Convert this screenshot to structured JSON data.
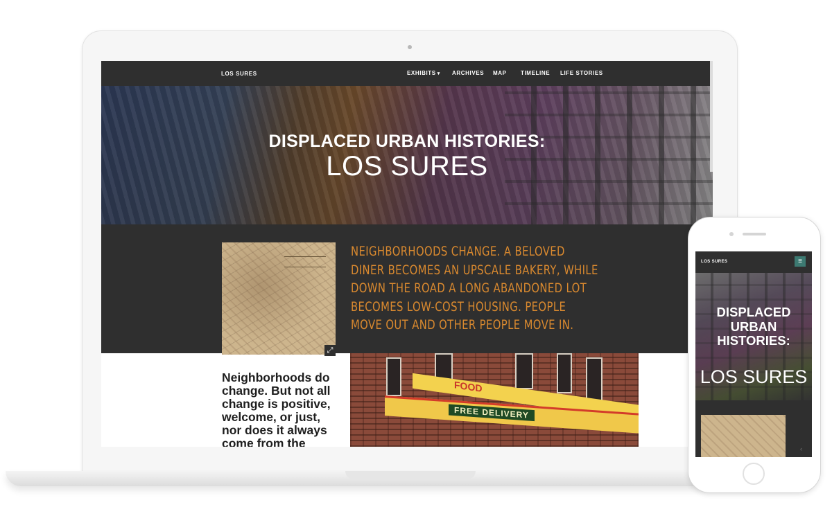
{
  "laptop": {
    "navbar": {
      "brand": "LOS SURES",
      "items": [
        {
          "label": "EXHIBITS",
          "has_dropdown": true
        },
        {
          "label": "ARCHIVES"
        },
        {
          "label": "MAP"
        },
        {
          "label": "TIMELINE"
        },
        {
          "label": "LIFE STORIES"
        }
      ],
      "caret": "▾"
    },
    "hero": {
      "title": "DISPLACED URBAN HISTORIES:",
      "subtitle": "LOS SURES"
    },
    "intro": {
      "text": "NEIGHBORHOODS CHANGE. A BELOVED DINER BECOMES AN UPSCALE BAKERY, WHILE DOWN THE ROAD A LONG ABANDONED LOT BECOMES LOW-COST HOUSING. PEOPLE MOVE OUT AND OTHER PEOPLE MOVE IN."
    },
    "body_text": "Neighborhoods do change.  But not all change is positive, welcome, or just, nor does it always come from the",
    "photo_signs": {
      "free_delivery": "FREE DELIVERY",
      "food": "FOOD"
    },
    "expand_icon": "⤢"
  },
  "phone": {
    "brand": "LOS SURES",
    "menu_icon": "≡",
    "hero": {
      "title": "DISPLACED URBAN HISTORIES:",
      "subtitle": "LOS SURES"
    },
    "arrow_icon": "‹"
  },
  "colors": {
    "dark": "#2f2f2f",
    "accent_orange": "#d9892f",
    "menu_teal": "#3d7a72"
  }
}
